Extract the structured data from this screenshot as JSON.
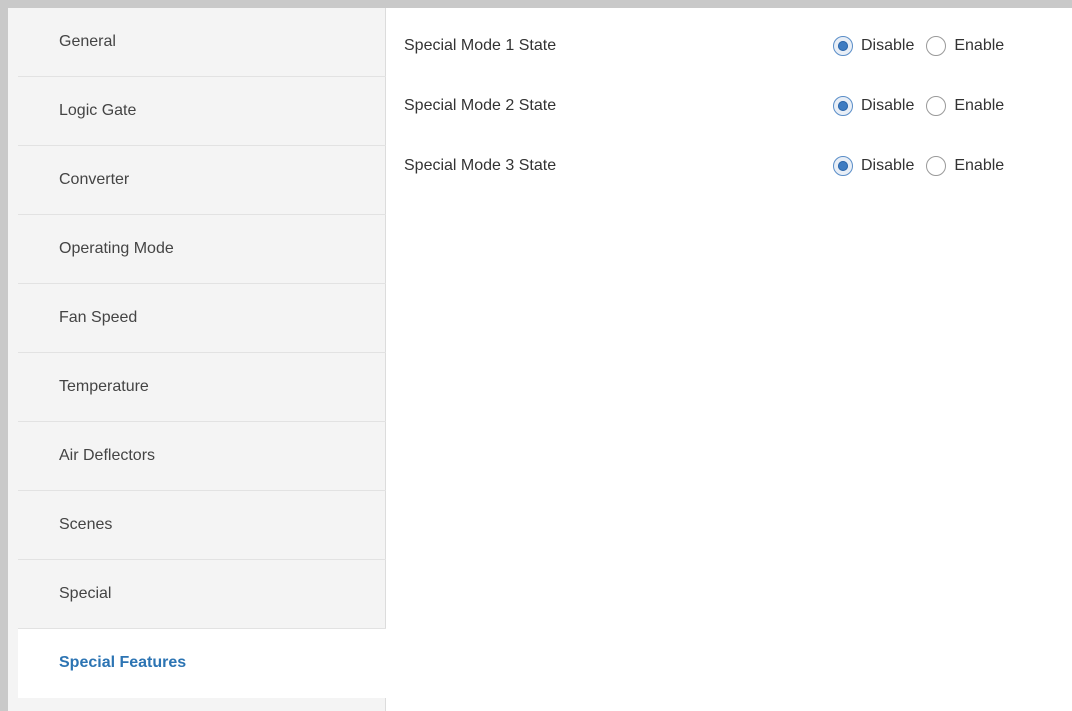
{
  "sidebar": {
    "items": [
      {
        "label": "General"
      },
      {
        "label": "Logic Gate"
      },
      {
        "label": "Converter"
      },
      {
        "label": "Operating Mode"
      },
      {
        "label": "Fan Speed"
      },
      {
        "label": "Temperature"
      },
      {
        "label": "Air Deflectors"
      },
      {
        "label": "Scenes"
      },
      {
        "label": "Special"
      },
      {
        "label": "Special Features",
        "active": true
      }
    ]
  },
  "colors": {
    "active_text": "#2c74b3",
    "radio_checked": "#3f7cc1",
    "sidebar_bg": "#f4f4f4"
  },
  "main": {
    "parameters": [
      {
        "label": "Special Mode 1 State",
        "options": [
          "Disable",
          "Enable"
        ],
        "selected": "Disable"
      },
      {
        "label": "Special Mode 2 State",
        "options": [
          "Disable",
          "Enable"
        ],
        "selected": "Disable"
      },
      {
        "label": "Special Mode 3 State",
        "options": [
          "Disable",
          "Enable"
        ],
        "selected": "Disable"
      }
    ]
  }
}
